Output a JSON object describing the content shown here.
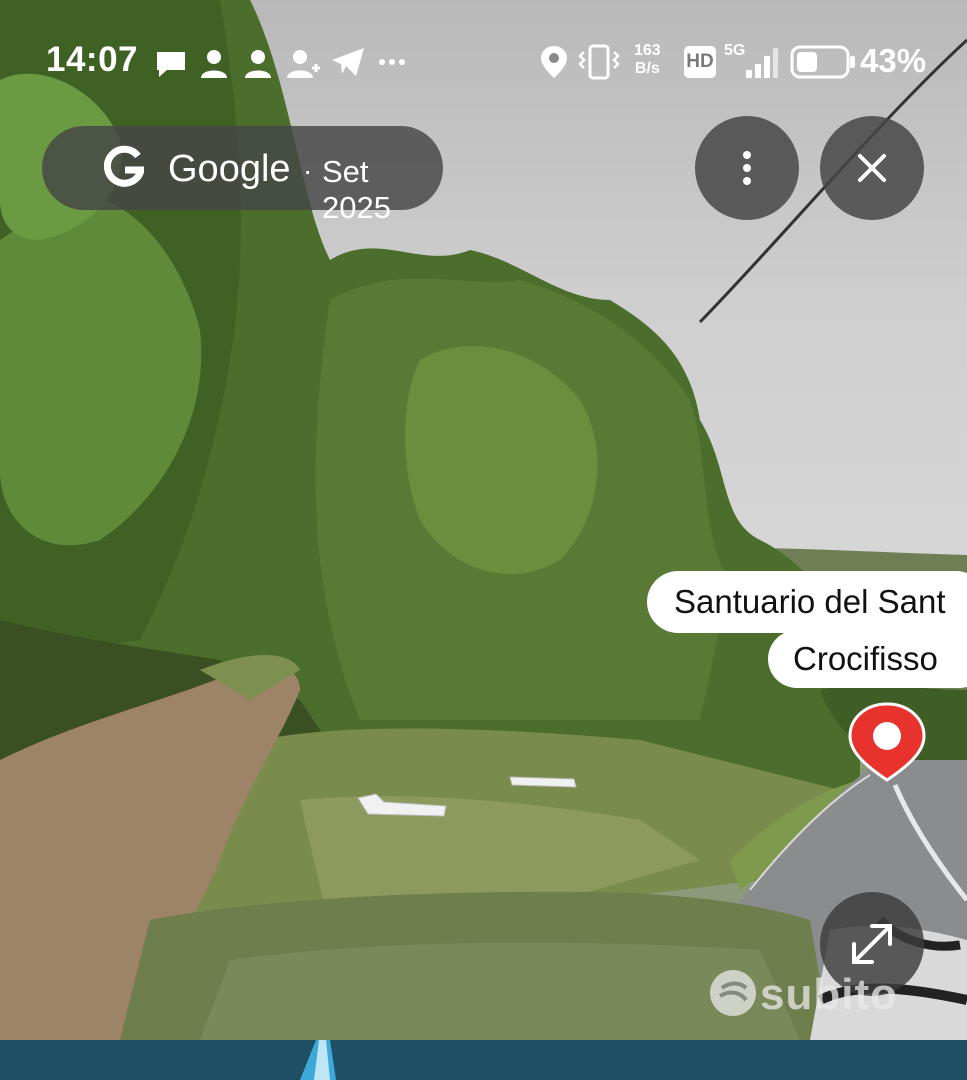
{
  "status_bar": {
    "time": "14:07",
    "net_speed_value": "163",
    "net_speed_unit": "B/s",
    "hd_badge": "HD",
    "network": "5G",
    "battery_percent": "43%",
    "battery_level": 0.43,
    "icons": [
      "message-icon",
      "contact-icon",
      "contact-icon",
      "add-contact-icon",
      "telegram-icon",
      "more-dots-icon",
      "location-icon",
      "vibrate-icon",
      "signal-icon",
      "battery-icon"
    ]
  },
  "viewer": {
    "brand": "Google",
    "separator": "·",
    "date": "Set 2025"
  },
  "place": {
    "name_line1": "Santuario del Sant",
    "name_line2": "Crocifisso"
  },
  "watermark": {
    "text": "subito"
  },
  "colors": {
    "accent_pin": "#e8322d",
    "bottom_bar": "#1f4f63"
  }
}
